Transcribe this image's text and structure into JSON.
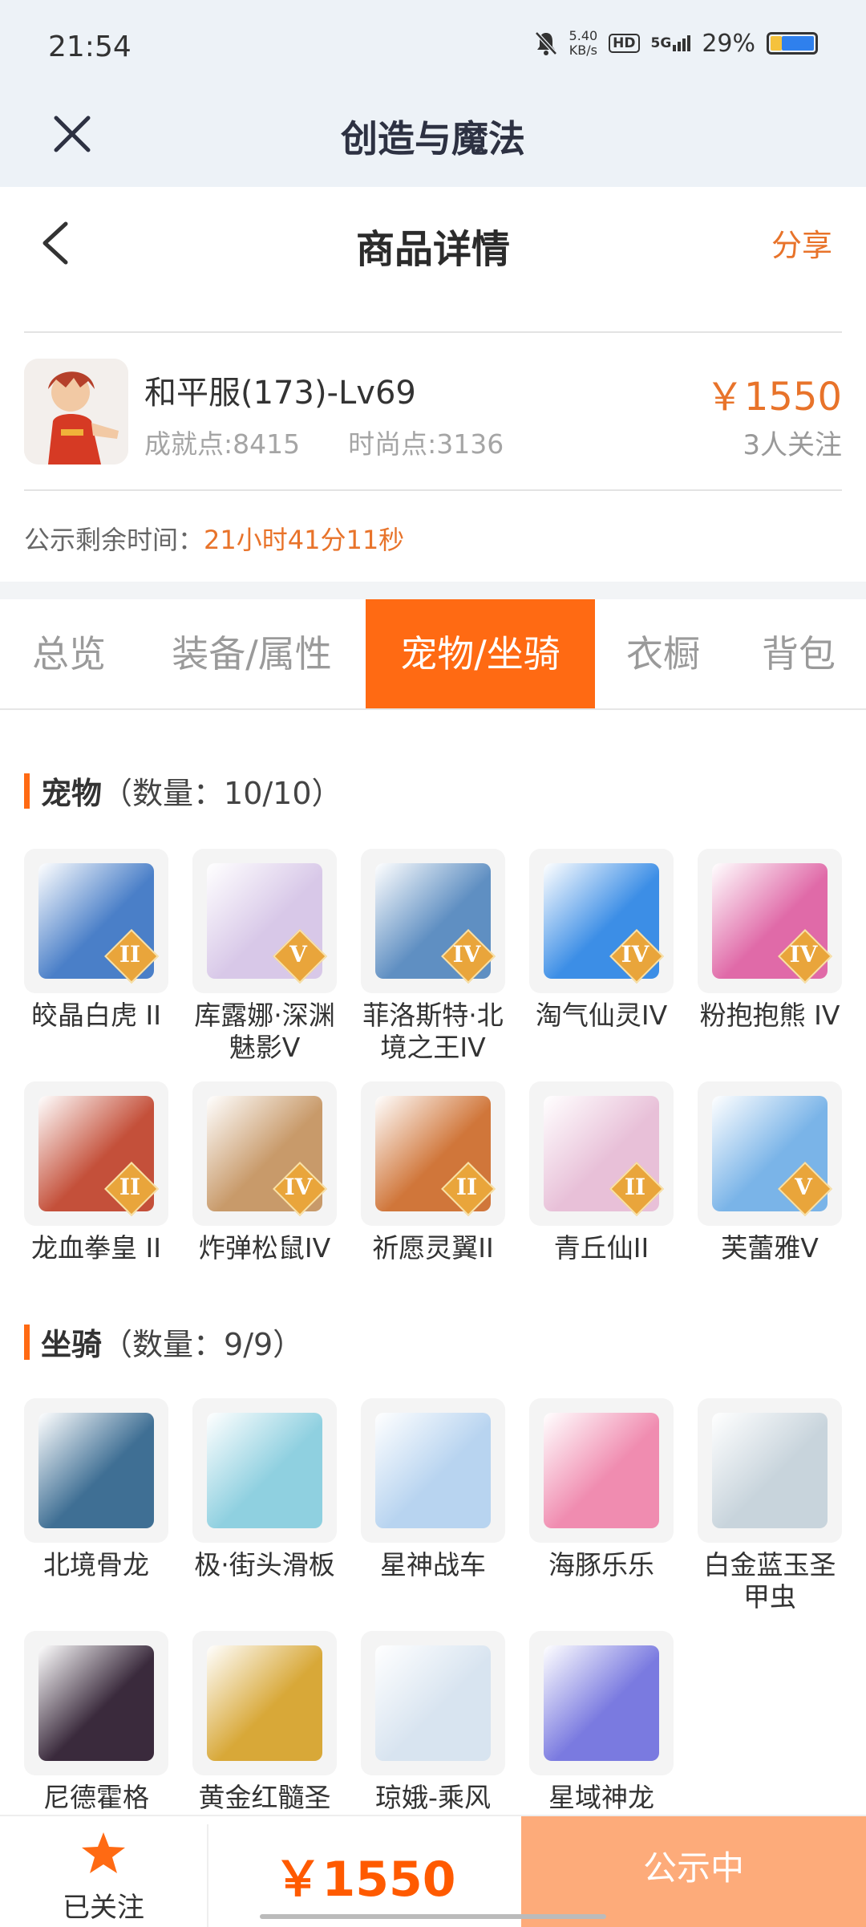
{
  "status_bar": {
    "time": "21:54",
    "net_speed_value": "5.40",
    "net_speed_unit": "KB/s",
    "hd": "HD",
    "signal": "5G",
    "battery": "29%",
    "icons": [
      "mute-icon",
      "hd-icon",
      "signal-5g-icon",
      "battery-icon"
    ]
  },
  "app_bar": {
    "title": "创造与魔法",
    "close_icon": "close-icon"
  },
  "nav": {
    "title": "商品详情",
    "share": "分享",
    "back_icon": "chevron-left-icon"
  },
  "product": {
    "name": "和平服(173)-Lv69",
    "achievement": "成就点:8415",
    "fashion": "时尚点:3136",
    "price": "￥1550",
    "followers": "3人关注"
  },
  "countdown": {
    "label": "公示剩余时间：",
    "time": "21小时41分11秒"
  },
  "tabs": [
    {
      "label": "总览"
    },
    {
      "label": "装备/属性"
    },
    {
      "label": "宠物/坐骑"
    },
    {
      "label": "衣橱"
    },
    {
      "label": "背包"
    }
  ],
  "active_tab": "宠物/坐骑",
  "pets": {
    "title": "宠物",
    "count": "（数量：10/10）",
    "items": [
      {
        "name": "皎晶白虎 II",
        "badge": "II",
        "color": "#4a7fc8"
      },
      {
        "name": "库露娜·深渊魅影V",
        "badge": "V",
        "color": "#d8c8e8"
      },
      {
        "name": "菲洛斯特·北境之王IV",
        "badge": "IV",
        "color": "#5f8fc2"
      },
      {
        "name": "淘气仙灵IV",
        "badge": "IV",
        "color": "#3c8ee6"
      },
      {
        "name": "粉抱抱熊 IV",
        "badge": "IV",
        "color": "#e06aa8"
      },
      {
        "name": "龙血拳皇 II",
        "badge": "II",
        "color": "#c4503a"
      },
      {
        "name": "炸弹松鼠IV",
        "badge": "IV",
        "color": "#c89a6a"
      },
      {
        "name": "祈愿灵翼II",
        "badge": "II",
        "color": "#d0763a"
      },
      {
        "name": "青丘仙II",
        "badge": "II",
        "color": "#e8c0d8"
      },
      {
        "name": "芙蕾雅V",
        "badge": "V",
        "color": "#7ab4e8"
      }
    ]
  },
  "mounts": {
    "title": "坐骑",
    "count": "（数量：9/9）",
    "items": [
      {
        "name": "北境骨龙",
        "color": "#3f6f94"
      },
      {
        "name": "极·街头滑板",
        "color": "#8fd0e0"
      },
      {
        "name": "星神战车",
        "color": "#b8d4f0"
      },
      {
        "name": "海豚乐乐",
        "color": "#f08cb0"
      },
      {
        "name": "白金蓝玉圣甲虫",
        "color": "#c8d4dc"
      },
      {
        "name": "尼德霍格",
        "color": "#3a2a3c"
      },
      {
        "name": "黄金红髓圣",
        "color": "#d8a838"
      },
      {
        "name": "琼娥-乘风",
        "color": "#d8e4f0"
      },
      {
        "name": "星域神龙",
        "color": "#7a7ae0"
      }
    ]
  },
  "bottom": {
    "follow_label": "已关注",
    "price": "￥1550",
    "status": "公示中",
    "star_color": "#ff6a13"
  }
}
